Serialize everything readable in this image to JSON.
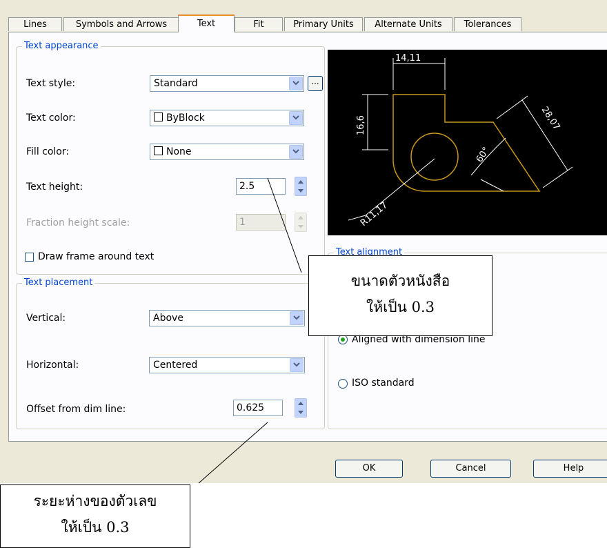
{
  "tabs": [
    {
      "label": "Lines",
      "active": false
    },
    {
      "label": "Symbols and Arrows",
      "active": false
    },
    {
      "label": "Text",
      "active": true
    },
    {
      "label": "Fit",
      "active": false
    },
    {
      "label": "Primary Units",
      "active": false
    },
    {
      "label": "Alternate Units",
      "active": false
    },
    {
      "label": "Tolerances",
      "active": false
    }
  ],
  "text_appearance": {
    "title": "Text appearance",
    "text_style_label": "Text style:",
    "text_style_value": "Standard",
    "text_style_button": "...",
    "text_color_label": "Text color:",
    "text_color_value": "ByBlock",
    "fill_color_label": "Fill color:",
    "fill_color_value": "None",
    "text_height_label": "Text height:",
    "text_height_value": "2.5",
    "fraction_label": "Fraction height scale:",
    "fraction_value": "1",
    "frame_label": "Draw frame around text",
    "frame_checked": false
  },
  "text_placement": {
    "title": "Text placement",
    "vertical_label": "Vertical:",
    "vertical_value": "Above",
    "horizontal_label": "Horizontal:",
    "horizontal_value": "Centered",
    "offset_label": "Offset from dim line:",
    "offset_value": "0.625"
  },
  "text_alignment": {
    "title": "Text alignment",
    "aligned_label": "Aligned with dimension line",
    "iso_label": "ISO standard",
    "selected": "Aligned with dimension line"
  },
  "preview": {
    "dim_top": "14,11",
    "dim_left": "16,6",
    "dim_right": "28,07",
    "dim_angle": "60°",
    "dim_radius": "R11,17",
    "bg_color": "#000000",
    "geometry_color": "#c8961e",
    "dim_color": "#ffffff"
  },
  "buttons": {
    "ok": "OK",
    "cancel": "Cancel",
    "help": "Help"
  },
  "callouts": {
    "text_height_line1": "ขนาดตัวหนังสือ",
    "text_height_line2": "ให้เป็น 0.3",
    "offset_line1": "ระยะห่างของตัวเลข",
    "offset_line2": "ให้เป็น 0.3"
  },
  "colors": {
    "dialog_bg": "#ece9d8",
    "panel_bg": "#fcfcfe",
    "group_title": "#0046d5",
    "active_tab_accent": "#e68b2c",
    "dropdown_button": "#c1d3fb"
  }
}
